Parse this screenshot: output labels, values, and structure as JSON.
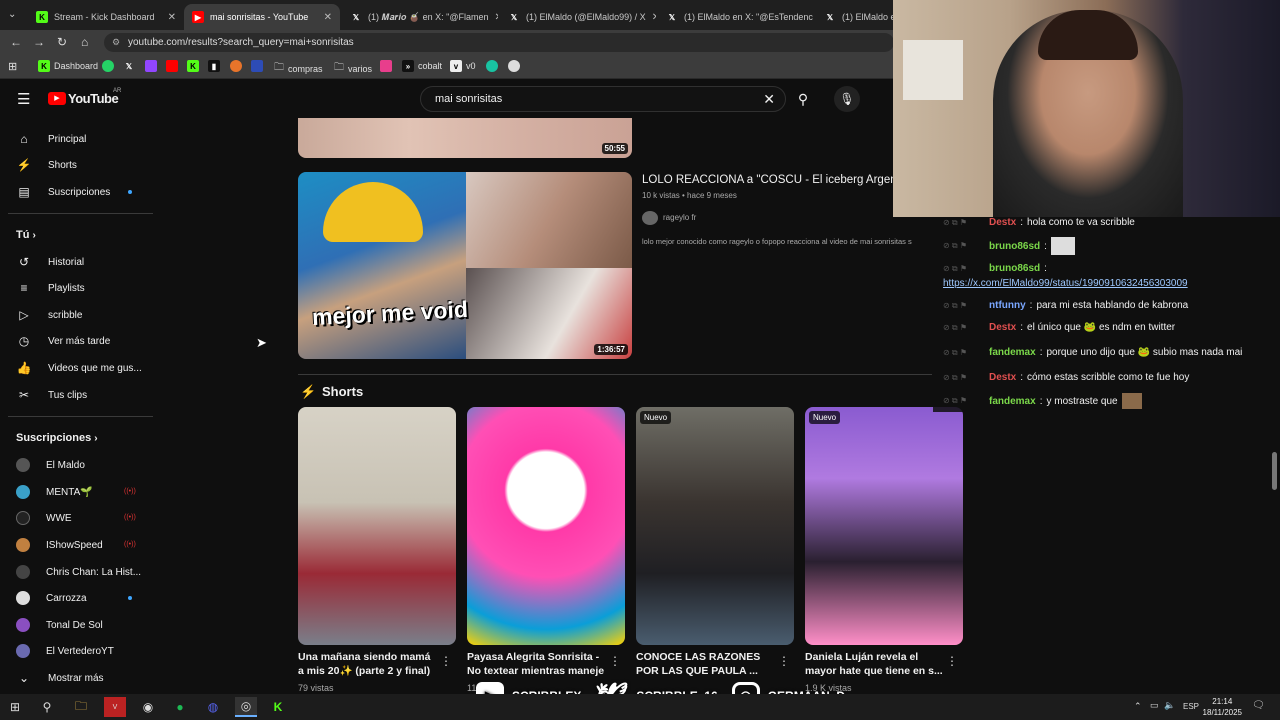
{
  "tabs": [
    {
      "label": "Stream - Kick Dashboard",
      "icon": "kick-icon"
    },
    {
      "label": "mai sonrisitas - YouTube",
      "icon": "youtube-icon"
    },
    {
      "label": "(1) 𝑴𝒂𝒓𝒊𝒐 🧉 en X: \"@Flamen",
      "icon": "x-icon"
    },
    {
      "label": "(1) ElMaldo (@ElMaldo99) / X",
      "icon": "x-icon"
    },
    {
      "label": "(1) ElMaldo en X: \"@EsTendenc",
      "icon": "x-icon"
    },
    {
      "label": "(1) ElMaldo en",
      "icon": "x-icon"
    }
  ],
  "address": "youtube.com/results?search_query=mai+sonrisitas",
  "bookmarks": [
    "Dashboard",
    "compras",
    "varios",
    "cobalt",
    "v0"
  ],
  "youtube": {
    "logo": "YouTube",
    "region": "AR",
    "search_value": "mai sonrisitas"
  },
  "sidebar": {
    "main": [
      "Principal",
      "Shorts",
      "Suscripciones"
    ],
    "you_header": "Tú",
    "you": [
      "Historial",
      "Playlists",
      "scribble",
      "Ver más tarde",
      "Videos que me gus...",
      "Tus clips"
    ],
    "subs_header": "Suscripciones",
    "subs": [
      "El Maldo",
      "MENTA🌱",
      "WWE",
      "IShowSpeed",
      "Chris Chan: La Hist...",
      "Carrozza",
      "Tonal De Sol",
      "El VertederoYT"
    ],
    "more": "Mostrar más"
  },
  "results": {
    "video1_duration": "50:55",
    "video2": {
      "title": "LOLO REACCIONA a \"COSCU - El iceberg Argent",
      "meta": "10 k vistas • hace 9 meses",
      "channel": "rageylo fr",
      "description": "lolo mejor conocido como rageylo o fopopo reacciona al video de mai sonrisitas s",
      "overlay_text": "mejor me void",
      "duration": "1:36:57"
    },
    "shorts_header": "Shorts",
    "shorts": [
      {
        "title": "Una mañana siendo mamá a mis 20✨ (parte 2 y final)",
        "views": "79 vistas",
        "badge": ""
      },
      {
        "title": "Payasa Alegrita Sonrisita - No textear mientras maneje",
        "views": "11",
        "badge": ""
      },
      {
        "title": "CONOCE LAS RAZONES POR LAS QUE PAULA ...",
        "views": "",
        "badge": "Nuevo"
      },
      {
        "title": "Daniela Luján revela el mayor hate que tiene en s...",
        "views": "1.9 K vistas",
        "badge": "Nuevo"
      }
    ]
  },
  "chat": [
    {
      "user": "Destx",
      "color": "#e05050",
      "text": "hola como te va scribble"
    },
    {
      "user": "bruno86sd",
      "color": "#7bd84a",
      "text": ""
    },
    {
      "user": "bruno86sd",
      "color": "#7bd84a",
      "text": ""
    },
    {
      "user": "",
      "color": "#9ec8ff",
      "text": "https://x.com/ElMaldo99/status/1990910632456303009"
    },
    {
      "user": "ntfunny",
      "color": "#7aa7ff",
      "text": "para mi esta hablando de kabrona"
    },
    {
      "user": "Destx",
      "color": "#e05050",
      "text": "el único que 🐸 es ndm en twitter"
    },
    {
      "user": "fandemax",
      "color": "#7bd84a",
      "text": "porque uno dijo que 🐸 subio mas nada mai"
    },
    {
      "user": "Destx",
      "color": "#e05050",
      "text": "cómo estas scribble como te fue hoy"
    },
    {
      "user": "fandemax",
      "color": "#7bd84a",
      "text": "y mostraste que"
    }
  ],
  "socials": [
    "SCRIBBLEX",
    "SCRIBBLE_16",
    "GERMAAN_D"
  ],
  "taskbar": {
    "lang": "ESP",
    "time": "21:14",
    "date": "18/11/2025"
  }
}
